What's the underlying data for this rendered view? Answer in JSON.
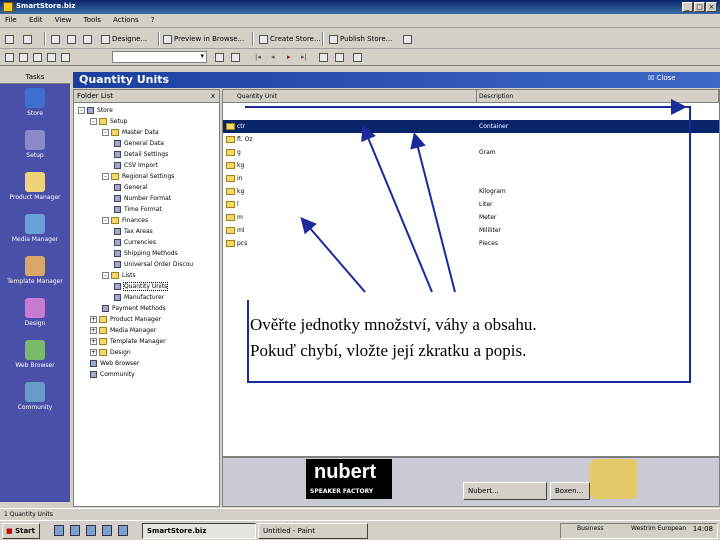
{
  "window": {
    "title": "SmartStore.biz"
  },
  "menu": [
    "File",
    "Edit",
    "View",
    "Tools",
    "Actions",
    "?"
  ],
  "toolbar": {
    "buttons": [
      {
        "label": "Designe..."
      },
      {
        "label": "Preview in Browse..."
      },
      {
        "label": "Create Store..."
      },
      {
        "label": "Publish Store..."
      }
    ]
  },
  "nav": {
    "header": "Tasks",
    "items": [
      {
        "label": "Store",
        "color": "#3d6fcf"
      },
      {
        "label": "Setup",
        "color": "#8a8ac8"
      },
      {
        "label": "Product Manager",
        "color": "#f0d27a"
      },
      {
        "label": "Media Manager",
        "color": "#6aa0d8"
      },
      {
        "label": "Template Manager",
        "color": "#d8a86a"
      },
      {
        "label": "Design",
        "color": "#c87ad0"
      },
      {
        "label": "Web Browser",
        "color": "#7ab86a"
      },
      {
        "label": "Community",
        "color": "#6a9ac8"
      }
    ]
  },
  "panel": {
    "title": "Quantity Units",
    "close_label": "Close"
  },
  "folders": {
    "header": "Folder List",
    "close": "x",
    "tree": [
      {
        "label": "Store",
        "depth": 0,
        "icon": "store-icon",
        "toggle": "-"
      },
      {
        "label": "Setup",
        "depth": 1,
        "icon": "folder-icon",
        "toggle": "-"
      },
      {
        "label": "Master Data",
        "depth": 2,
        "icon": "folder-icon",
        "toggle": "-"
      },
      {
        "label": "General Data",
        "depth": 3,
        "icon": "gear-icon"
      },
      {
        "label": "Detail Settings",
        "depth": 3,
        "icon": "gear-icon"
      },
      {
        "label": "CSV Import",
        "depth": 3,
        "icon": "gear-icon"
      },
      {
        "label": "Regional Settings",
        "depth": 2,
        "icon": "folder-icon",
        "toggle": "-"
      },
      {
        "label": "General",
        "depth": 3,
        "icon": "gear-icon"
      },
      {
        "label": "Number Format",
        "depth": 3,
        "icon": "gear-icon"
      },
      {
        "label": "Time Format",
        "depth": 3,
        "icon": "gear-icon"
      },
      {
        "label": "Finances",
        "depth": 2,
        "icon": "folder-icon",
        "toggle": "-"
      },
      {
        "label": "Tax Areas",
        "depth": 3,
        "icon": "gear-icon"
      },
      {
        "label": "Currencies",
        "depth": 3,
        "icon": "gear-icon"
      },
      {
        "label": "Shipping Methods",
        "depth": 3,
        "icon": "gear-icon"
      },
      {
        "label": "Universal Order Discou",
        "depth": 3,
        "icon": "gear-icon"
      },
      {
        "label": "Lists",
        "depth": 2,
        "icon": "folder-icon",
        "toggle": "-"
      },
      {
        "label": "Quantity Units",
        "depth": 3,
        "icon": "gear-icon",
        "selected": true
      },
      {
        "label": "Manufacturer",
        "depth": 3,
        "icon": "gear-icon"
      },
      {
        "label": "Payment Methods",
        "depth": 2,
        "icon": "gear-icon"
      },
      {
        "label": "Product Manager",
        "depth": 1,
        "icon": "folder-icon",
        "toggle": "+"
      },
      {
        "label": "Media Manager",
        "depth": 1,
        "icon": "folder-icon",
        "toggle": "+"
      },
      {
        "label": "Template Manager",
        "depth": 1,
        "icon": "folder-icon",
        "toggle": "+"
      },
      {
        "label": "Design",
        "depth": 1,
        "icon": "folder-icon",
        "toggle": "+"
      },
      {
        "label": "Web Browser",
        "depth": 1,
        "icon": "gear-icon"
      },
      {
        "label": "Community",
        "depth": 1,
        "icon": "gear-icon"
      }
    ]
  },
  "list": {
    "columns": [
      "Quantity Unit",
      "Description"
    ],
    "rows": [
      {
        "unit": "ctr",
        "desc": "Container",
        "selected": true
      },
      {
        "unit": "fl. Oz",
        "desc": ""
      },
      {
        "unit": "g",
        "desc": "Gram"
      },
      {
        "unit": "kg",
        "desc": ""
      },
      {
        "unit": "in",
        "desc": ""
      },
      {
        "unit": "kg",
        "desc": "Kilogram"
      },
      {
        "unit": "l",
        "desc": "Liter"
      },
      {
        "unit": "m",
        "desc": "Meter"
      },
      {
        "unit": "ml",
        "desc": "Mililiter"
      },
      {
        "unit": "pcs",
        "desc": "Pieces"
      }
    ]
  },
  "annotation": {
    "line1": "Ověřte jednotky množství, váhy a obsahu.",
    "line2": "Pokuď chybí, vložte její zkratku a popis."
  },
  "banner": {
    "brand": "nubert",
    "tagline": "SPEAKER FACTORY"
  },
  "lower_tabs": [
    "Nubert...",
    "Boxen..."
  ],
  "status": {
    "text": "1 Quantity Units"
  },
  "taskbar": {
    "start": "Start",
    "items": [
      {
        "label": "SmartStore.biz",
        "active": true
      },
      {
        "label": "Untitled - Paint",
        "active": false
      }
    ],
    "tray": [
      "Business",
      "Westrim European"
    ],
    "clock": "14:08"
  }
}
